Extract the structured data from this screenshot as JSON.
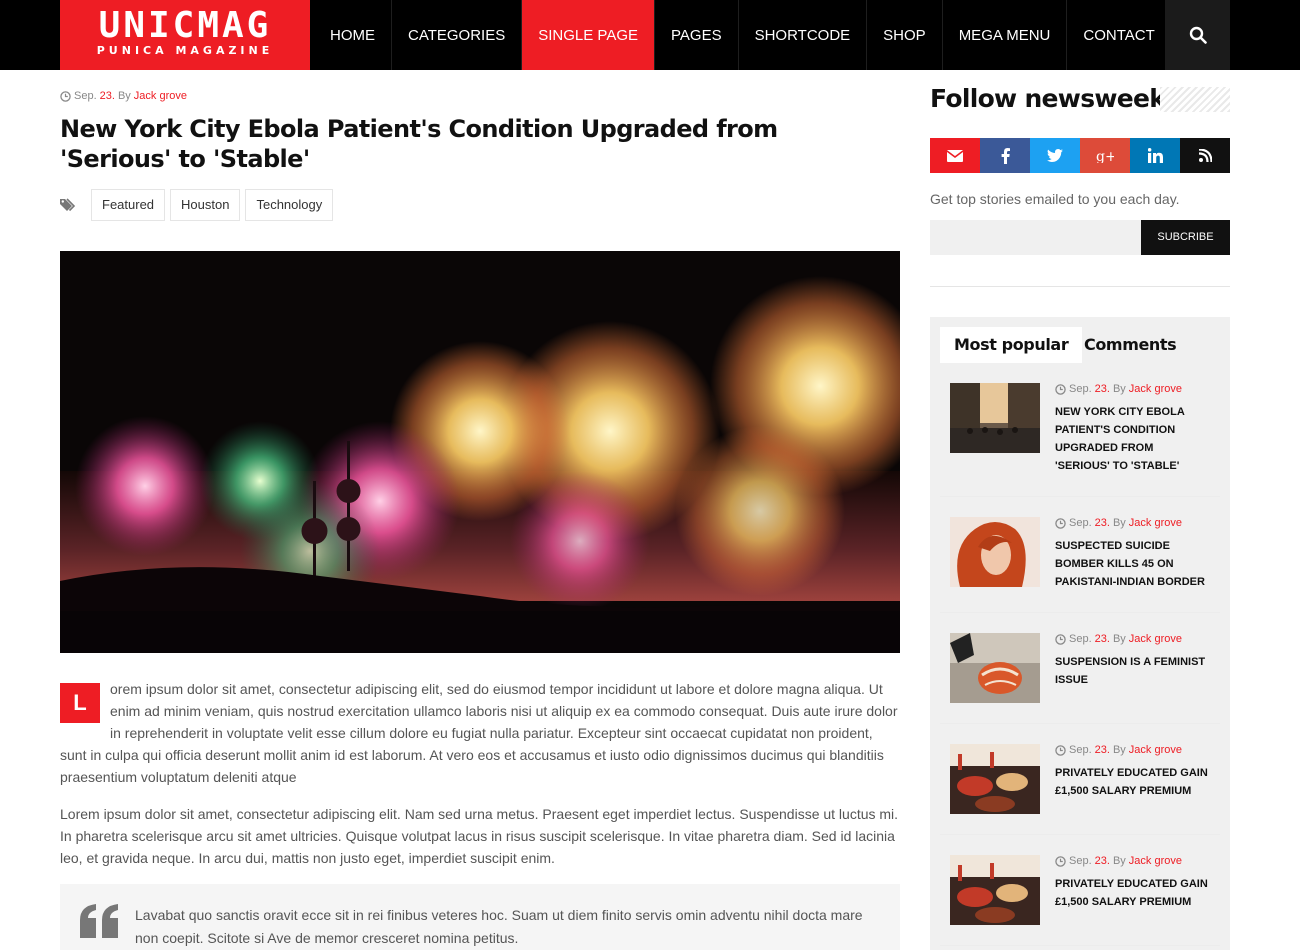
{
  "header": {
    "logo_main": "UNICMAG",
    "logo_sub": "PUNICA MAGAZINE",
    "nav": [
      "HOME",
      "CATEGORIES",
      "SINGLE PAGE",
      "PAGES",
      "SHORTCODE",
      "SHOP",
      "MEGA MENU",
      "CONTACT"
    ],
    "active_nav": "SINGLE PAGE",
    "search_icon": "search-icon"
  },
  "article": {
    "meta": {
      "month": "Sep.",
      "day": "23.",
      "by": "By",
      "author": "Jack grove"
    },
    "title": "New York City Ebola Patient's Condition Upgraded from 'Serious' to 'Stable'",
    "tags": [
      "Featured",
      "Houston",
      "Technology"
    ],
    "hero_image": "fireworks-over-city-towers",
    "dropcap": "L",
    "paragraph1": "orem ipsum dolor sit amet, consectetur adipiscing elit, sed do eiusmod tempor incididunt ut labore et dolore magna aliqua. Ut enim ad minim veniam, quis nostrud exercitation ullamco laboris nisi ut aliquip ex ea commodo consequat. Duis aute irure dolor in reprehenderit in voluptate velit esse cillum dolore eu fugiat nulla pariatur. Excepteur sint occaecat cupidatat non proident, sunt in culpa qui officia deserunt mollit anim id est laborum. At vero eos et accusamus et iusto odio dignissimos ducimus qui blanditiis praesentium voluptatum deleniti atque",
    "paragraph2": "Lorem ipsum dolor sit amet, consectetur adipiscing elit. Nam sed urna metus. Praesent eget imperdiet lectus. Suspendisse ut luctus mi. In pharetra scelerisque arcu sit amet ultricies. Quisque volutpat lacus in risus suscipit scelerisque. In vitae pharetra diam. Sed id lacinia leo, et gravida neque. In arcu dui, mattis non justo eget, imperdiet suscipit enim.",
    "quote": "Lavabat quo sanctis oravit ecce sit in rei finibus veteres hoc. Suam ut diem finito servis omin adventu nihil docta mare non coepit. Scitote si Ave de memor cresceret nomina petitus."
  },
  "sidebar": {
    "follow_title": "Follow newsweek",
    "social": [
      {
        "icon": "email-icon",
        "color": "#ee1d24"
      },
      {
        "icon": "facebook-icon",
        "color": "#3b5998"
      },
      {
        "icon": "twitter-icon",
        "color": "#1da1f2"
      },
      {
        "icon": "google-plus-icon",
        "color": "#dd4b39"
      },
      {
        "icon": "linkedin-icon",
        "color": "#0077b5"
      },
      {
        "icon": "rss-icon",
        "color": "#111111"
      }
    ],
    "subscribe_text": "Get top stories emailed to you each day.",
    "subscribe_button": "SUBCRIBE",
    "tabs": [
      "Most popular",
      "Comments"
    ],
    "posts": [
      {
        "month": "Sep.",
        "day": "23.",
        "by": "By",
        "author": "Jack grove",
        "title": "NEW YORK CITY EBOLA PATIENT'S CONDITION UPGRADED FROM 'SERIOUS' TO 'STABLE'",
        "thumb": "street-crowd"
      },
      {
        "month": "Sep.",
        "day": "23.",
        "by": "By",
        "author": "Jack grove",
        "title": "SUSPECTED SUICIDE BOMBER KILLS 45 ON PAKISTANI-INDIAN BORDER",
        "thumb": "red-hair-woman"
      },
      {
        "month": "Sep.",
        "day": "23.",
        "by": "By",
        "author": "Jack grove",
        "title": "SUSPENSION IS A FEMINIST ISSUE",
        "thumb": "running-shoe"
      },
      {
        "month": "Sep.",
        "day": "23.",
        "by": "By",
        "author": "Jack grove",
        "title": "PRIVATELY EDUCATED GAIN £1,500 SALARY PREMIUM",
        "thumb": "food-table"
      },
      {
        "month": "Sep.",
        "day": "23.",
        "by": "By",
        "author": "Jack grove",
        "title": "PRIVATELY EDUCATED GAIN £1,500 SALARY PREMIUM",
        "thumb": "food-table"
      }
    ]
  },
  "colors": {
    "accent": "#ee1d24",
    "header_bg": "#000000"
  }
}
